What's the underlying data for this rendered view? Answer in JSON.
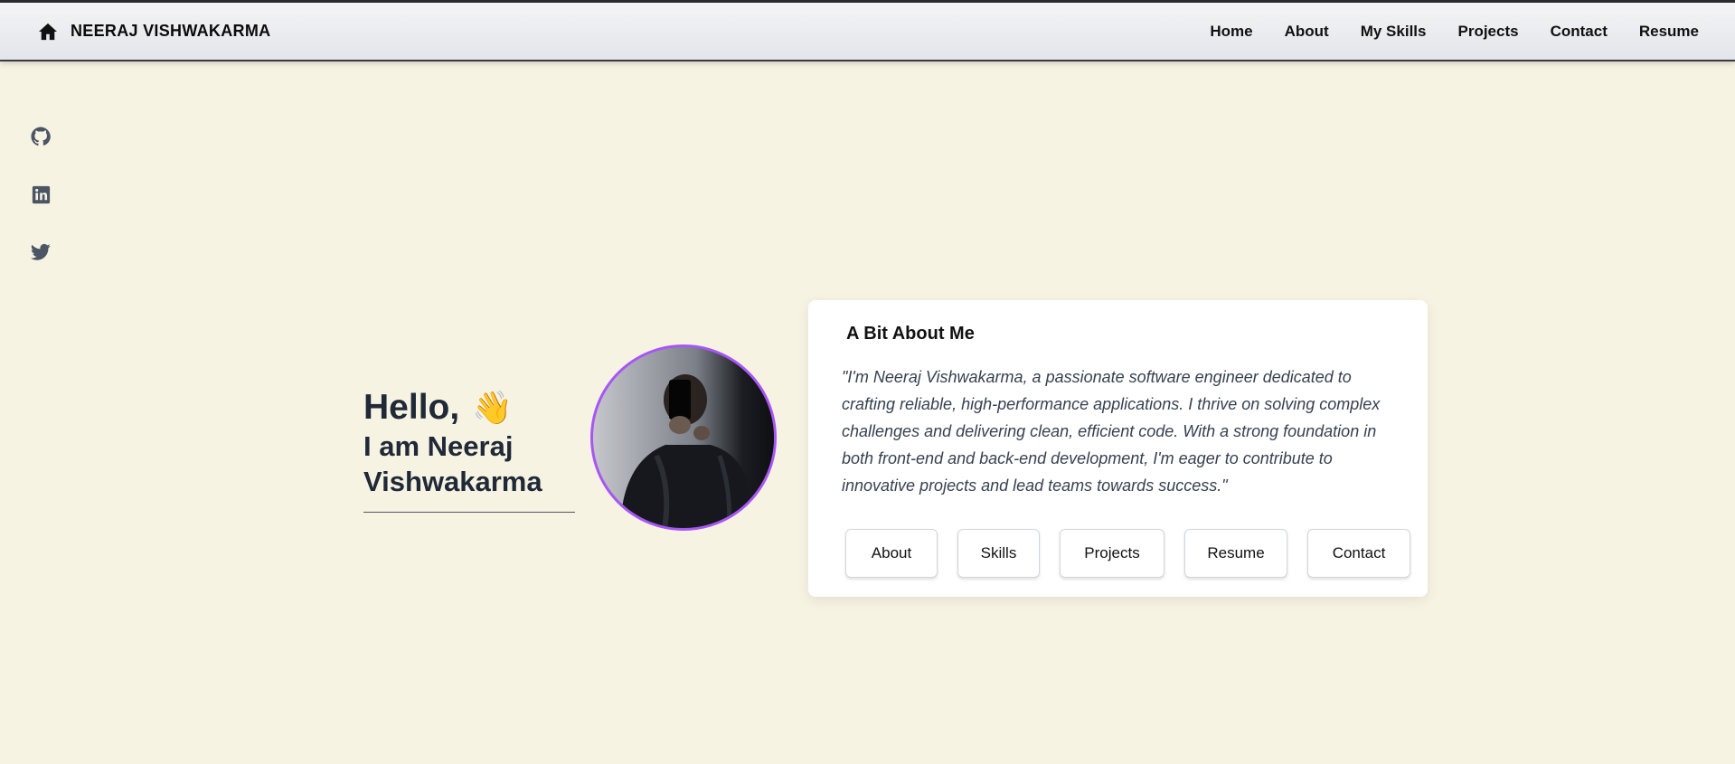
{
  "navbar": {
    "brand_icon": "home-icon",
    "brand": "NEERAJ VISHWAKARMA",
    "links": [
      "Home",
      "About",
      "My Skills",
      "Projects",
      "Contact",
      "Resume"
    ]
  },
  "social": {
    "icons": [
      "github-icon",
      "linkedin-icon",
      "twitter-icon"
    ],
    "color": "#4b5563"
  },
  "hero": {
    "greeting": "Hello,",
    "wave_emoji": "👋",
    "name_line1": "I am Neeraj",
    "name_line2": "Vishwakarma",
    "avatar_border_color": "#a855f7"
  },
  "about_card": {
    "title": "A Bit About Me",
    "quote": "\"I'm Neeraj Vishwakarma, a passionate software engineer dedicated to crafting reliable, high-performance applications. I thrive on solving complex challenges and delivering clean, efficient code. With a strong foundation in both front-end and back-end development, I'm eager to contribute to innovative projects and lead teams towards success.\"",
    "buttons": [
      "About",
      "Skills",
      "Projects",
      "Resume",
      "Contact"
    ]
  },
  "colors": {
    "background": "#f7f3e3",
    "accent": "#a855f7"
  }
}
